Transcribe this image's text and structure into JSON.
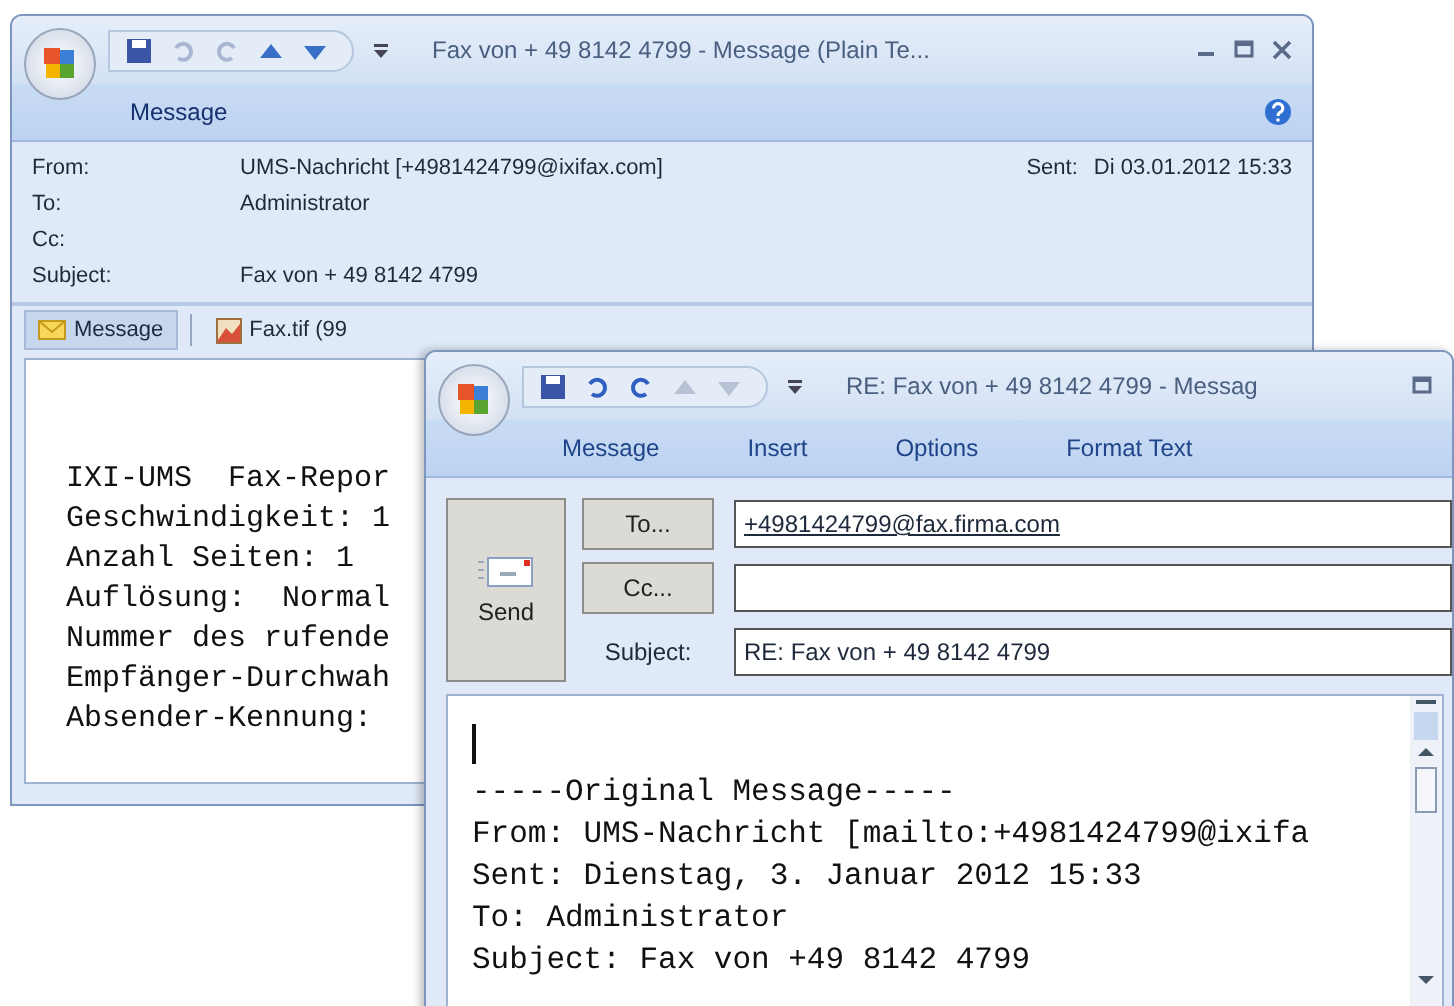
{
  "back_window": {
    "title": "Fax von + 49 8142 4799 - Message (Plain Te...",
    "tabs": [
      {
        "label": "Message",
        "selected": true
      }
    ],
    "header": {
      "from_label": "From:",
      "from": "UMS-Nachricht [+4981424799@ixifax.com]",
      "sent_label": "Sent:",
      "sent": "Di 03.01.2012 15:33",
      "to_label": "To:",
      "to": "Administrator",
      "cc_label": "Cc:",
      "subject_label": "Subject:",
      "subject": "Fax von + 49 8142 4799"
    },
    "attachments": [
      {
        "label": "Message",
        "kind": "mail",
        "selected": true
      },
      {
        "label": "Fax.tif (99",
        "kind": "image",
        "selected": false
      }
    ],
    "body": [
      "IXI-UMS  Fax-Repor",
      "Geschwindigkeit: 1",
      "Anzahl Seiten: 1",
      "Auflösung:  Normal",
      "Nummer des rufende",
      "Empfänger-Durchwah",
      "Absender-Kennung:"
    ]
  },
  "front_window": {
    "title": "RE: Fax von + 49 8142 4799 - Messag",
    "tabs": [
      {
        "label": "Message",
        "selected": false
      },
      {
        "label": "Insert",
        "selected": false
      },
      {
        "label": "Options",
        "selected": false
      },
      {
        "label": "Format Text",
        "selected": false
      }
    ],
    "send": "Send",
    "to_button": "To...",
    "to": "+4981424799@fax.firma.com",
    "cc_button": "Cc...",
    "subject_label": "Subject:",
    "subject": "RE: Fax von + 49 8142 4799",
    "body": [
      "-----Original Message-----",
      "From: UMS-Nachricht [mailto:+4981424799@ixifa",
      "Sent: Dienstag, 3. Januar 2012 15:33",
      "To: Administrator",
      "Subject: Fax von +49 8142 4799"
    ]
  }
}
